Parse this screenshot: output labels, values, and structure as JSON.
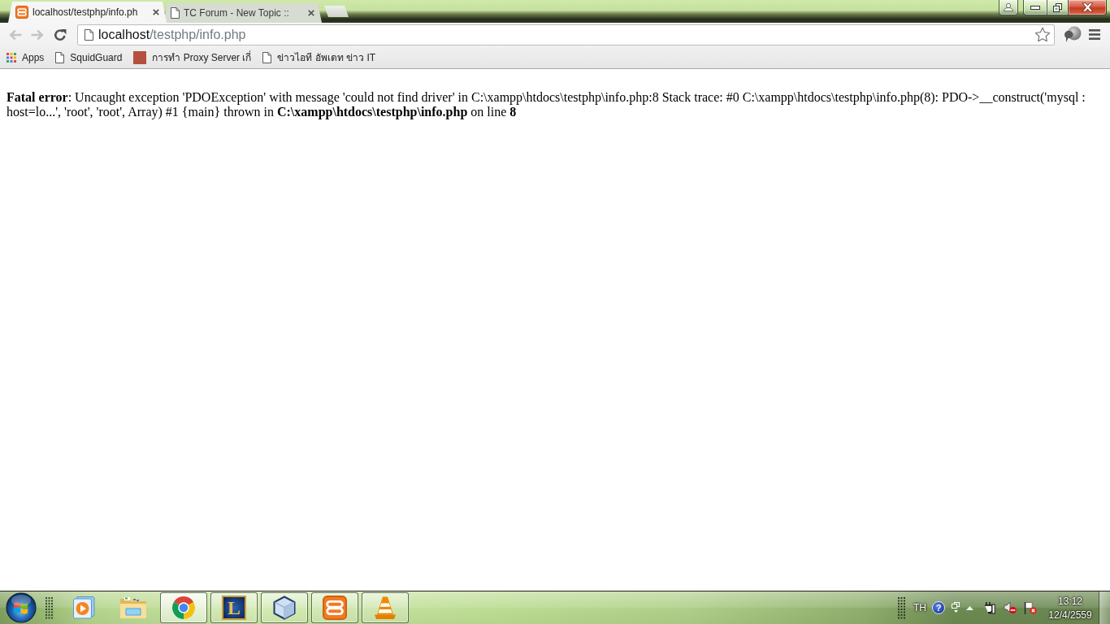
{
  "tabs": [
    {
      "kind": "xampp",
      "title": "localhost/testphp/info.ph",
      "selected": true
    },
    {
      "kind": "page",
      "title": "TC Forum - New Topic ::",
      "selected": false
    }
  ],
  "toolbar": {
    "back": {
      "disabled": true
    },
    "forward": {
      "disabled": true
    },
    "address": {
      "host": "localhost",
      "path": "/testphp/info.php"
    }
  },
  "bookmarks": [
    {
      "kind": "apps",
      "label": "Apps"
    },
    {
      "kind": "page",
      "label": "SquidGuard"
    },
    {
      "kind": "photo",
      "label": "การทำ Proxy Server เกี่"
    },
    {
      "kind": "page",
      "label": "ข่าวไอที อัพเดท ข่าว IT"
    }
  ],
  "page": {
    "message": "**Fatal error**: Uncaught exception 'PDOException' with message 'could not find driver' in C:\\xampp\\htdocs\\testphp\\info.php:8 Stack trace: #0 C:\\xampp\\htdocs\\testphp\\info.php(8): PDO->__construct('mysql : host=lo...', 'root', 'root', Array) #1 {main} thrown in **C:\\xampp\\htdocs\\testphp\\info.php** on line **8**"
  },
  "taskbar": {
    "apps": [
      {
        "kind": "media-player",
        "running": false,
        "selected": false
      },
      {
        "kind": "explorer",
        "running": false,
        "selected": false
      },
      {
        "kind": "chrome",
        "running": true,
        "selected": true
      },
      {
        "kind": "game",
        "logo_text": "L",
        "running": true,
        "selected": false
      },
      {
        "kind": "cube",
        "running": true,
        "selected": false
      },
      {
        "kind": "xampp",
        "running": true,
        "selected": false
      },
      {
        "kind": "vlc",
        "running": true,
        "selected": false
      }
    ],
    "tray": {
      "language": "TH",
      "help": "?",
      "time": "13:12",
      "date": "12/4/2559"
    }
  }
}
